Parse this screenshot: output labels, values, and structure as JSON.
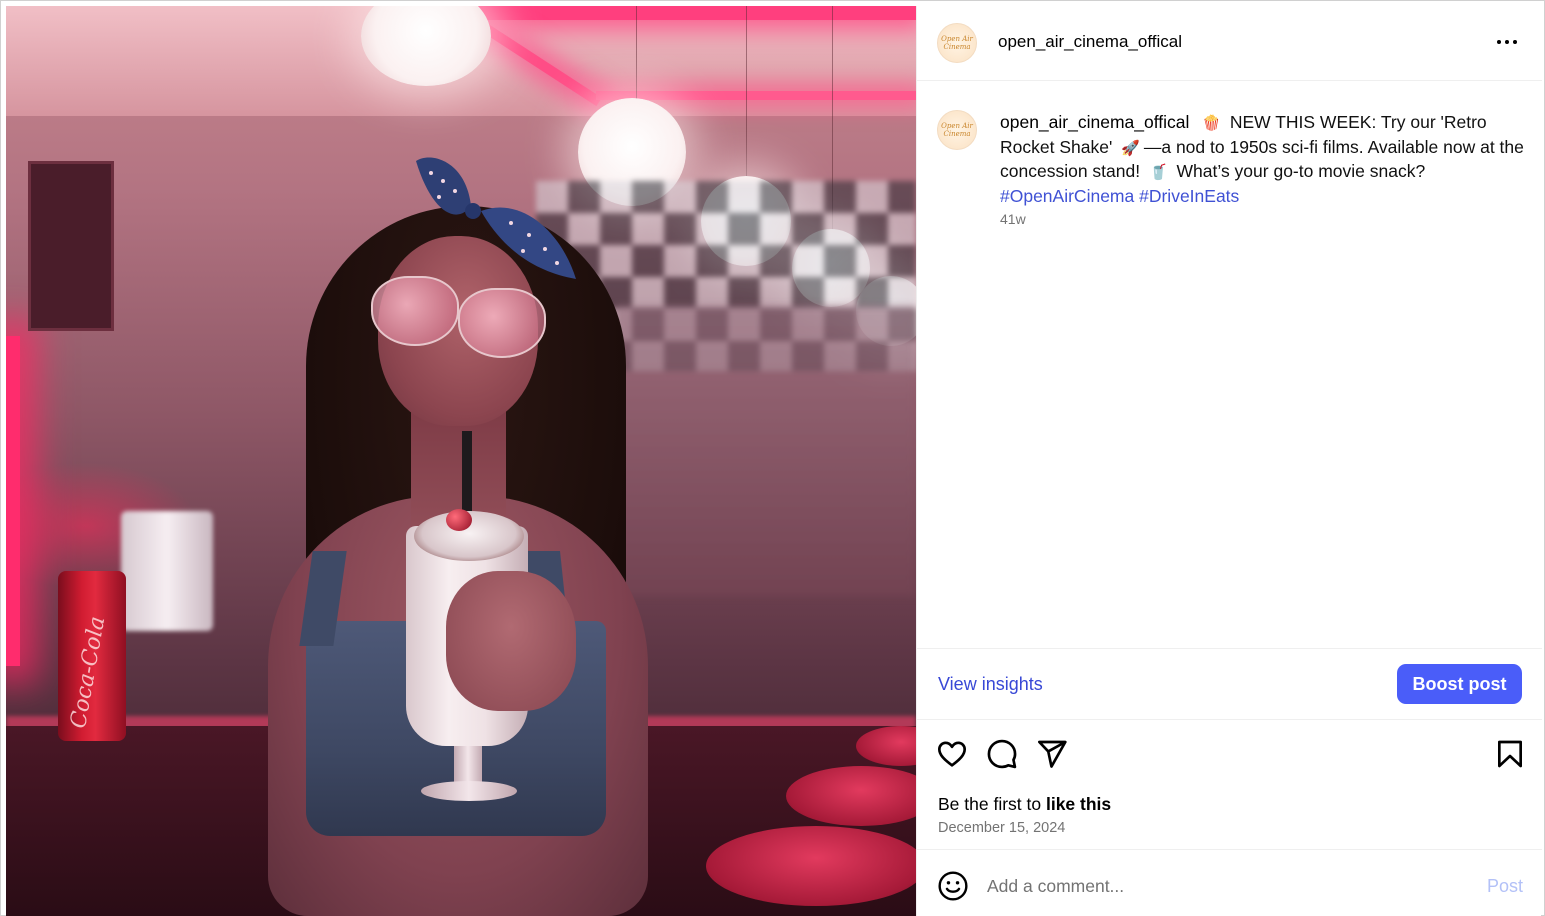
{
  "post": {
    "username": "open_air_cinema_offical",
    "avatar_text": "Open Air Cinema",
    "more_label": "More options",
    "caption": {
      "user": "open_air_cinema_offical",
      "emoji_1": "🍿",
      "text_1": "NEW THIS WEEK: Try our 'Retro Rocket Shake'",
      "emoji_2": "🚀",
      "text_2": "—a nod to 1950s sci-fi films. Available now at the concession stand!",
      "emoji_3": "🥤",
      "text_3": "What’s your go-to movie snack?",
      "hashtag_1": "#OpenAirCinema",
      "hashtag_2": "#DriveInEats"
    },
    "time_ago": "41w",
    "view_insights_label": "View insights",
    "boost_label": "Boost post",
    "likes": {
      "prefix": "Be the first to ",
      "bold": "like this"
    },
    "date": "December 15, 2024",
    "comment": {
      "placeholder": "Add a comment...",
      "post_label": "Post"
    },
    "photo_can_text": "Coca-Cola"
  },
  "colors": {
    "accent": "#4a5df9",
    "link": "#3848d6",
    "hashtag": "#3f51d4",
    "muted": "#737373",
    "post_disabled": "#b3c1f7"
  },
  "icons": {
    "header": [
      "more-horizontal-icon"
    ],
    "actions": [
      "heart-icon",
      "comment-icon",
      "share-icon",
      "bookmark-icon"
    ],
    "comment": [
      "emoji-icon"
    ]
  }
}
